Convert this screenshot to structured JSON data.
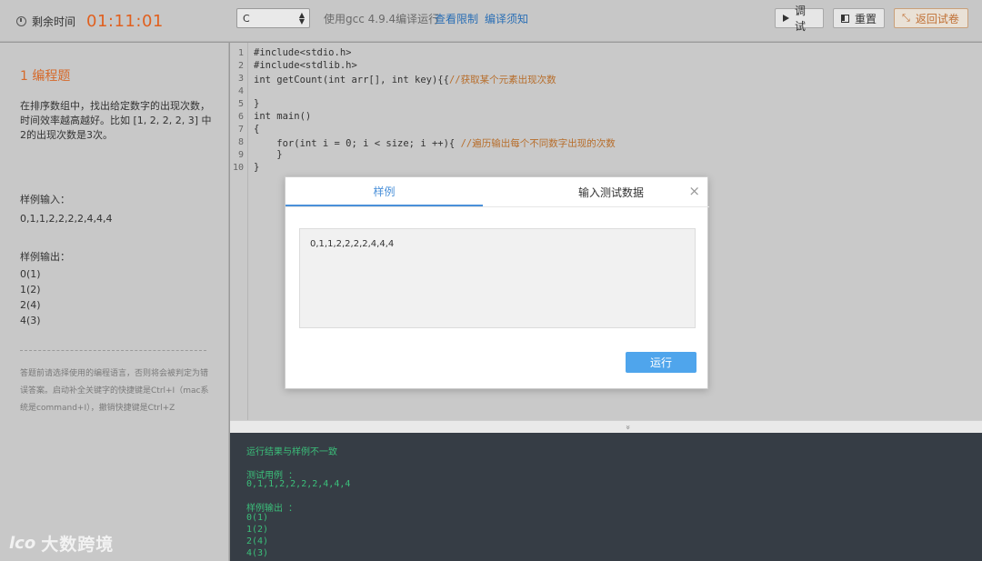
{
  "timer": {
    "label": "剩余时间",
    "value": "01:11:01",
    "icon": "clock-icon"
  },
  "toolbar": {
    "language": "C",
    "compile_info": "使用gcc 4.9.4编译运行",
    "link_limits": "查看限制",
    "link_compile_notes": "编译须知",
    "debug_label": "调试",
    "reset_label": "重置",
    "return_label": "返回试卷"
  },
  "problem": {
    "number_title": "1  编程题",
    "description": "在排序数组中，找出给定数字的出现次数，时间效率越高越好。比如 [1, 2, 2, 2, 3] 中2的出现次数是3次。",
    "sample_input_label": "样例输入：",
    "sample_input": "0,1,1,2,2,2,2,4,4,4",
    "sample_output_label": "样例输出：",
    "sample_output": [
      "0(1)",
      "1(2)",
      "2(4)",
      "4(3)"
    ],
    "tip": "答题前请选择使用的编程语言，否则将会被判定为错误答案。启动补全关键字的快捷键是Ctrl+I（mac系统是command+I），撤销快捷键是Ctrl+Z"
  },
  "editor": {
    "line_numbers": [
      "1",
      "2",
      "3",
      "4",
      "5",
      "6",
      "7",
      "8",
      "9",
      "10"
    ],
    "lines": [
      "#include<stdio.h>",
      "#include<stdlib.h>",
      "int getCount(int arr[], int key){{//获取某个元素出现次数",
      "",
      "}",
      "int main()",
      "{",
      "    for(int i = 0; i < size; i ++){ //遍历输出每个不同数字出现的次数",
      "    }",
      "}"
    ]
  },
  "modal": {
    "tab_sample": "样例",
    "tab_input": "输入测试数据",
    "close": "×",
    "sample_value": "0,1,1,2,2,2,2,4,4,4",
    "run_label": "运行"
  },
  "splitter": {
    "icon": "chevron-double-down-icon",
    "glyph": "»"
  },
  "console": {
    "result": "运行结果与样例不一致",
    "test_case_label": "测试用例 ：",
    "test_case_value": "0,1,1,2,2,2,2,4,4,4",
    "sample_output_label": "样例输出 ：",
    "sample_output": [
      "0(1)",
      "1(2)",
      "2(4)",
      "4(3)"
    ]
  },
  "watermark": {
    "logo": "lco",
    "text": "大数跨境"
  },
  "colors": {
    "timer": "#e0601f",
    "accent": "#4a90d9",
    "console_bg": "#363d45",
    "console_text": "#3bbf7a"
  }
}
